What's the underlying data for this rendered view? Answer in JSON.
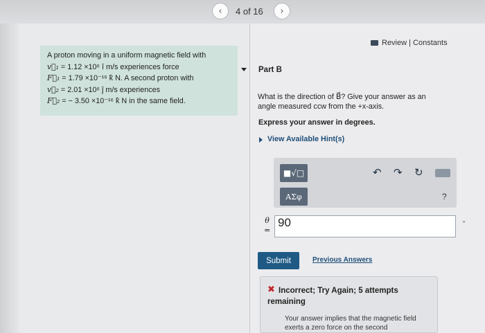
{
  "nav": {
    "prev_icon": "‹",
    "counter": "4 of 16",
    "next_icon": "›"
  },
  "problem": {
    "line1": "A proton moving in a uniform magnetic field with",
    "v1_sym": "v⃗₁",
    "v1_val": " = 1.12 ×10⁶ î m/s experiences force",
    "F1_sym": "F⃗₁",
    "F1_val": " = 1.79 ×10⁻¹⁶ k̂ N. A second proton with",
    "v2_sym": "v⃗₂",
    "v2_val": " = 2.01 ×10⁶ ĵ m/s experiences",
    "F2_sym": "F⃗₂",
    "F2_val": " = − 3.50 ×10⁻¹⁶ k̂ N in the same field."
  },
  "header": {
    "review_constants": "Review | Constants"
  },
  "part": {
    "title": "Part B"
  },
  "question": {
    "text": "What is the direction of B⃗? Give your answer as an angle measured ccw from the +x-axis.",
    "instruction": "Express your answer in degrees.",
    "hint_link": "View Available Hint(s)"
  },
  "toolbar": {
    "template_label": "■√□",
    "greek_label": "ΑΣφ",
    "undo_icon": "↶",
    "redo_icon": "↷",
    "reset_icon": "↻",
    "help_label": "?"
  },
  "answer": {
    "variable": "θ",
    "equals": "=",
    "value": "90",
    "unit": "∘"
  },
  "actions": {
    "submit": "Submit",
    "previous_answers": "Previous Answers"
  },
  "feedback": {
    "status_icon": "✖",
    "title": "Incorrect; Try Again; 5 attempts remaining",
    "body": "Your answer implies that the magnetic field exerts a zero force on the second"
  }
}
